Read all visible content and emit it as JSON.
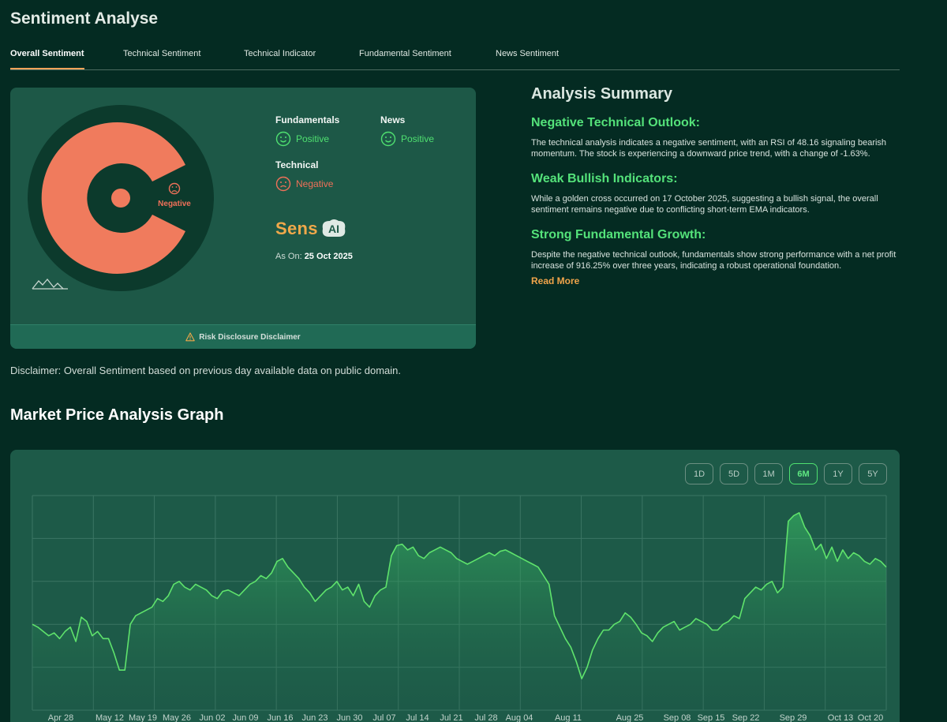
{
  "page": {
    "title": "Sentiment Analyse"
  },
  "tabs": [
    {
      "label": "Overall Sentiment",
      "active": true
    },
    {
      "label": "Technical Sentiment",
      "active": false
    },
    {
      "label": "Technical Indicator",
      "active": false
    },
    {
      "label": "Fundamental Sentiment",
      "active": false
    },
    {
      "label": "News Sentiment",
      "active": false
    }
  ],
  "sentiment": {
    "overall_label": "Negative",
    "fundamentals": {
      "label": "Fundamentals",
      "value": "Positive"
    },
    "news": {
      "label": "News",
      "value": "Positive"
    },
    "technical": {
      "label": "Technical",
      "value": "Negative"
    },
    "brand_text": "Sens",
    "brand_badge": "AI",
    "as_on_label": "As On:",
    "as_on_date": "25 Oct 2025",
    "risk_disclaimer": "Risk Disclosure Disclaimer",
    "colors": {
      "positive": "#4fe070",
      "negative": "#ef7059",
      "accent": "#f0a84a"
    }
  },
  "disclaimer": "Disclaimer: Overall Sentiment based on previous day available data on public domain.",
  "summary": {
    "title": "Analysis Summary",
    "sections": [
      {
        "heading": "Negative Technical Outlook:",
        "body": "The technical analysis indicates a negative sentiment, with an RSI of 48.16 signaling bearish momentum. The stock is experiencing a downward price trend, with a change of -1.63%."
      },
      {
        "heading": "Weak Bullish Indicators:",
        "body": "While a golden cross occurred on 17 October 2025, suggesting a bullish signal, the overall sentiment remains negative due to conflicting short-term EMA indicators."
      },
      {
        "heading": "Strong Fundamental Growth:",
        "body": "Despite the negative technical outlook, fundamentals show strong performance with a net profit increase of 916.25% over three years, indicating a robust operational foundation."
      }
    ],
    "read_more": "Read More"
  },
  "graph": {
    "title": "Market Price Analysis Graph",
    "ranges": [
      {
        "label": "1D",
        "active": false
      },
      {
        "label": "5D",
        "active": false
      },
      {
        "label": "1M",
        "active": false
      },
      {
        "label": "6M",
        "active": true
      },
      {
        "label": "1Y",
        "active": false
      },
      {
        "label": "5Y",
        "active": false
      }
    ]
  },
  "chart_data": {
    "type": "area",
    "x_tick_labels": [
      "Apr 28",
      "May 12",
      "May 19",
      "May 26",
      "Jun 02",
      "Jun 09",
      "Jun 16",
      "Jun 23",
      "Jun 30",
      "Jul 07",
      "Jul 14",
      "Jul 21",
      "Jul 28",
      "Aug 04",
      "Aug 11",
      "Aug 25",
      "Sep 08",
      "Sep 15",
      "Sep 22",
      "Sep 29",
      "Oct 13",
      "Oct 20"
    ],
    "values": [
      60,
      58,
      55,
      52,
      54,
      50,
      55,
      58,
      48,
      65,
      62,
      52,
      55,
      50,
      50,
      40,
      28,
      28,
      60,
      66,
      68,
      70,
      72,
      78,
      76,
      80,
      88,
      90,
      86,
      84,
      88,
      86,
      84,
      80,
      78,
      83,
      84,
      82,
      80,
      84,
      88,
      90,
      94,
      92,
      96,
      104,
      106,
      100,
      96,
      92,
      86,
      82,
      76,
      80,
      84,
      86,
      90,
      84,
      86,
      80,
      88,
      76,
      72,
      80,
      84,
      86,
      108,
      115,
      116,
      112,
      114,
      108,
      106,
      110,
      112,
      114,
      112,
      110,
      106,
      104,
      102,
      104,
      106,
      108,
      110,
      108,
      111,
      112,
      110,
      108,
      106,
      104,
      102,
      100,
      94,
      88,
      66,
      58,
      50,
      44,
      34,
      22,
      30,
      42,
      50,
      56,
      56,
      60,
      62,
      68,
      65,
      60,
      54,
      52,
      48,
      54,
      58,
      60,
      62,
      56,
      58,
      60,
      64,
      62,
      60,
      56,
      56,
      60,
      62,
      66,
      64,
      78,
      82,
      86,
      84,
      88,
      90,
      82,
      86,
      132,
      136,
      138,
      128,
      122,
      112,
      116,
      106,
      114,
      104,
      112,
      106,
      110,
      108,
      104,
      102,
      106,
      104,
      100
    ],
    "ylim": [
      0,
      150
    ],
    "grid": true,
    "legend": "none",
    "line_color": "#5fe36c"
  }
}
